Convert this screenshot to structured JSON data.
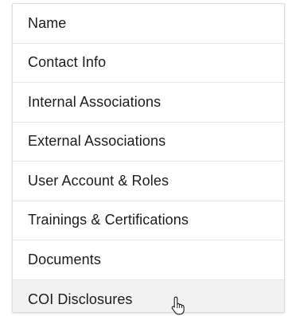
{
  "menu": {
    "items": [
      {
        "label": "Name"
      },
      {
        "label": "Contact Info"
      },
      {
        "label": "Internal Associations"
      },
      {
        "label": "External Associations"
      },
      {
        "label": "User Account & Roles"
      },
      {
        "label": "Trainings & Certifications"
      },
      {
        "label": "Documents"
      },
      {
        "label": "COI Disclosures"
      }
    ],
    "hovered_item": "COI Disclosures"
  },
  "icons": {
    "cursor": "hand-pointer-icon"
  }
}
